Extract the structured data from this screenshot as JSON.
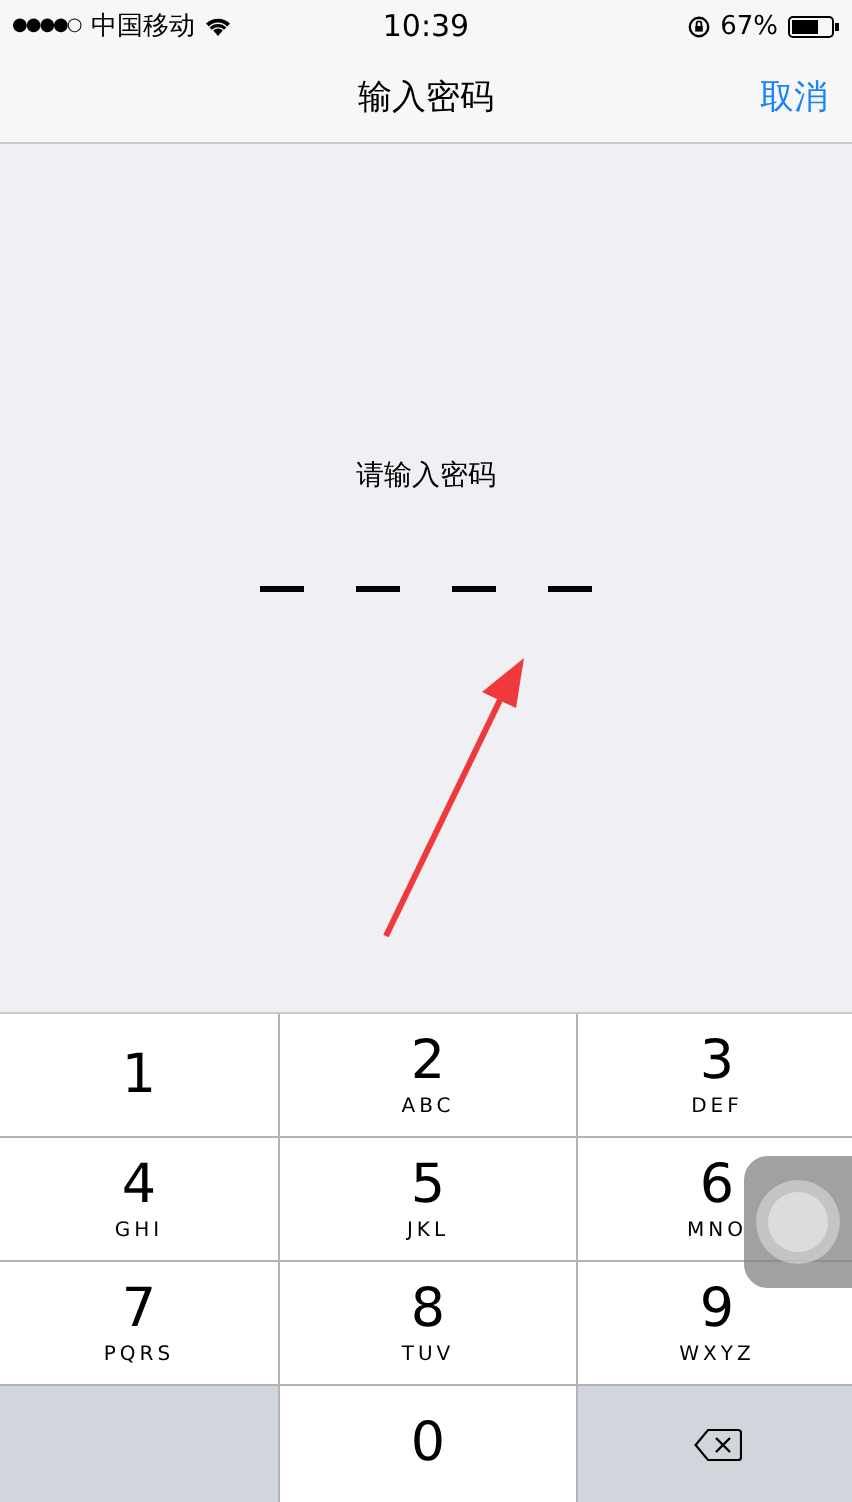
{
  "status_bar": {
    "signal_dots": "●●●●○",
    "carrier": "中国移动",
    "time": "10:39",
    "battery": "67%"
  },
  "nav_bar": {
    "title": "输入密码",
    "cancel": "取消"
  },
  "passcode": {
    "prompt": "请输入密码",
    "digits": [
      {
        "filled": false
      },
      {
        "filled": false
      },
      {
        "filled": false
      },
      {
        "filled": false
      }
    ]
  },
  "keypad": [
    {
      "kind": "digit",
      "digit": "1"
    },
    {
      "kind": "digit",
      "digit": "2",
      "letters": "ABC"
    },
    {
      "kind": "digit",
      "digit": "3",
      "letters": "DEF"
    },
    {
      "kind": "digit",
      "digit": "4",
      "letters": "GHI"
    },
    {
      "kind": "digit",
      "digit": "5",
      "letters": "JKL"
    },
    {
      "kind": "digit",
      "digit": "6",
      "letters": "MNO"
    },
    {
      "kind": "digit",
      "digit": "7",
      "letters": "PQRS"
    },
    {
      "kind": "digit",
      "digit": "8",
      "letters": "TUV"
    },
    {
      "kind": "digit",
      "digit": "9",
      "letters": "WXYZ"
    },
    {
      "kind": "blank"
    },
    {
      "kind": "digit",
      "digit": "0"
    },
    {
      "kind": "delete"
    }
  ]
}
